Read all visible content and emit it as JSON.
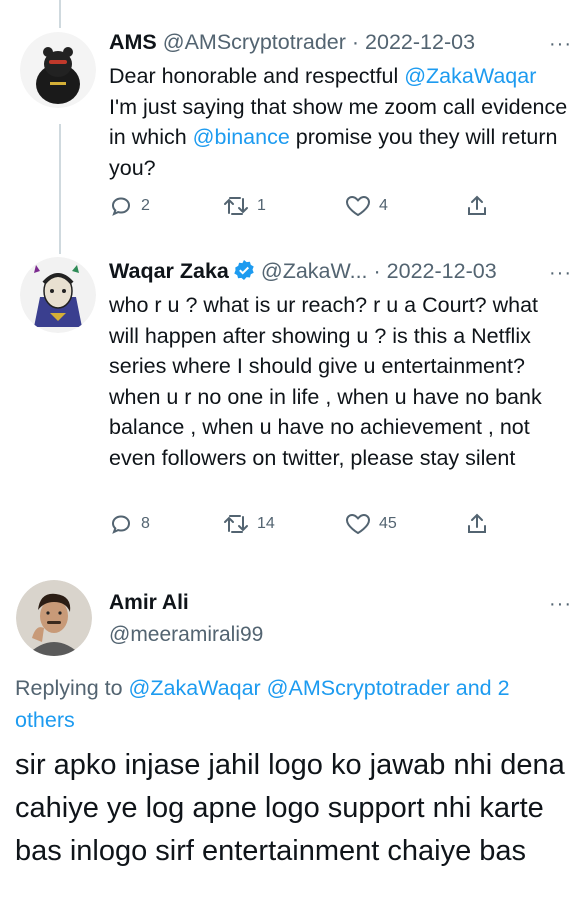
{
  "tweets": [
    {
      "name": "AMS",
      "handle": "@AMScryptotrader",
      "separator": "·",
      "date": "2022-12-03",
      "text": {
        "t1": "Dear honorable and respectful ",
        "m1": "@ZakaWaqar",
        "t2": " I'm just saying that  show me zoom call evidence in which ",
        "m2": "@binance",
        "t3": " promise you they will return you?"
      },
      "replies": "2",
      "retweets": "1",
      "likes": "4"
    },
    {
      "name": "Waqar Zaka",
      "handle": "@ZakaW...",
      "separator": "·",
      "date": "2022-12-03",
      "text": "who r u ? what is ur reach? r u a Court? what will happen after showing u ? is this a Netflix series where I should give u entertainment? when u r no one in life , when u have no bank balance , when u have no achievement , not even followers on twitter, please stay silent",
      "replies": "8",
      "retweets": "14",
      "likes": "45"
    }
  ],
  "main_tweet": {
    "name": "Amir Ali",
    "handle": "@meeramirali99",
    "replying_prefix": "Replying to ",
    "replying_mentions": "@ZakaWaqar @AMScryptotrader and 2 others",
    "text": "sir apko injase jahil logo ko jawab nhi dena cahiye ye log apne logo support nhi karte bas inlogo sirf entertainment chaiye bas"
  },
  "more_label": "···",
  "icons": {
    "reply": "reply-icon",
    "retweet": "retweet-icon",
    "like": "heart-icon",
    "share": "share-icon",
    "verified": "verified-badge-icon",
    "more": "more-options-icon"
  },
  "colors": {
    "link": "#1d9bf0",
    "secondary": "#536471",
    "text": "#0f1419",
    "thread_line": "#cfd9de"
  }
}
